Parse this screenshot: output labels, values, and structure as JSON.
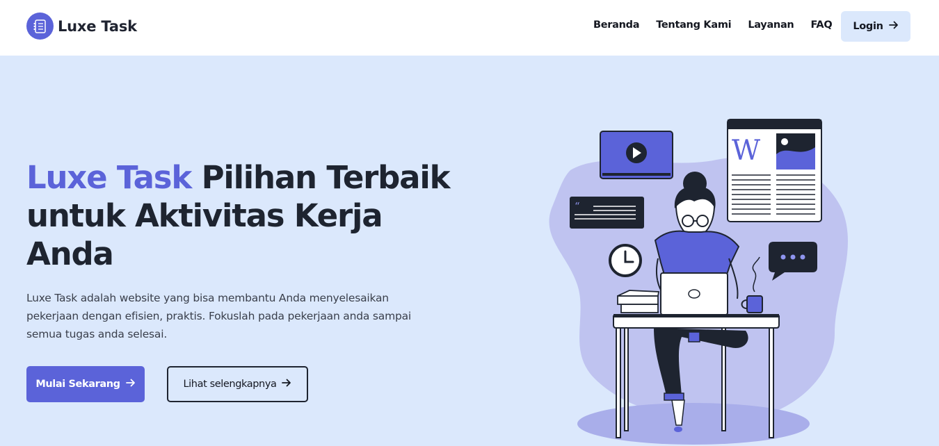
{
  "brand": {
    "name": "Luxe Task",
    "logo_icon": "task-list-icon"
  },
  "nav": {
    "links": [
      "Beranda",
      "Tentang Kami",
      "Layanan",
      "FAQ"
    ],
    "login_label": "Login"
  },
  "hero": {
    "headline_accent": "Luxe Task",
    "headline_rest": " Pilihan Terbaik untuk Aktivitas Kerja Anda",
    "description": "Luxe Task adalah website yang bisa membantu Anda menyelesaikan pekerjaan dengan efisien, praktis. Fokuslah pada pekerjaan anda sampai semua tugas anda selesai.",
    "primary_button": "Mulai Sekarang",
    "secondary_button": "Lihat selengkapnya",
    "illustration_letter": "W"
  },
  "colors": {
    "accent": "#5b63d9",
    "hero_background": "#dbe8fc",
    "text_dark": "#1e2430"
  }
}
